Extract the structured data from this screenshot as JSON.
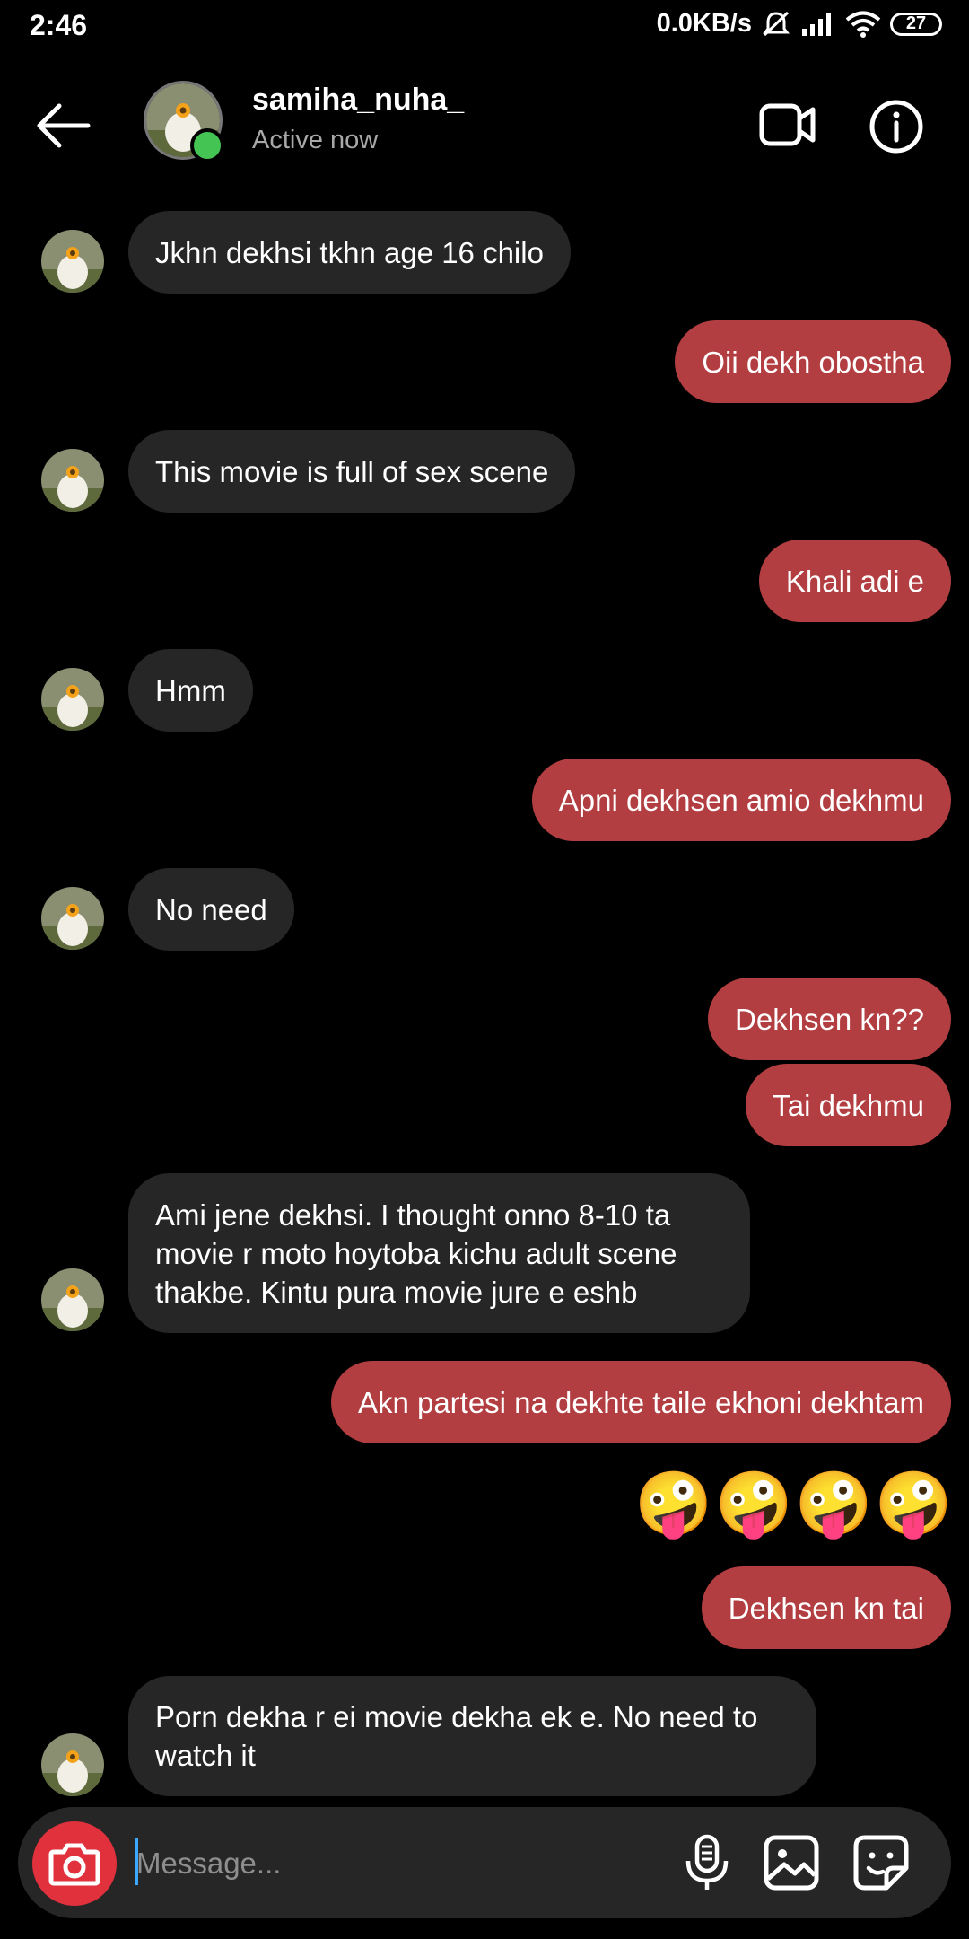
{
  "status_bar": {
    "time": "2:46",
    "network_speed": "0.0KB/s",
    "battery": "27",
    "icons": [
      "mute-icon",
      "signal-icon",
      "wifi-icon",
      "battery-icon"
    ]
  },
  "header": {
    "username": "samiha_nuha_",
    "status": "Active now",
    "icons": [
      "back-arrow-icon",
      "video-call-icon",
      "info-icon"
    ],
    "online_color": "#44c553"
  },
  "messages": [
    {
      "from": "them",
      "text": "Jkhn dekhsi tkhn age 16 chilo"
    },
    {
      "from": "me",
      "text": "Oii dekh obostha"
    },
    {
      "from": "them",
      "text": "This movie is full of sex scene"
    },
    {
      "from": "me",
      "text": "Khali adi e"
    },
    {
      "from": "them",
      "text": "Hmm"
    },
    {
      "from": "me",
      "text": "Apni dekhsen amio dekhmu"
    },
    {
      "from": "them",
      "text": "No need"
    },
    {
      "from": "me",
      "text": "Dekhsen kn??"
    },
    {
      "from": "me",
      "text": "Tai dekhmu"
    },
    {
      "from": "them",
      "text": "Ami jene dekhsi. I thought onno 8-10 ta movie r moto hoytoba kichu adult scene thakbe. Kintu pura movie jure e eshb"
    },
    {
      "from": "me",
      "text": "Akn partesi na dekhte taile ekhoni dekhtam"
    },
    {
      "from": "me",
      "text": "🤪🤪🤪🤪"
    },
    {
      "from": "me",
      "text": "Dekhsen kn tai"
    },
    {
      "from": "them",
      "text": "Porn dekha r ei movie dekha ek e. No need to watch it"
    }
  ],
  "composer": {
    "placeholder": "Message...",
    "icons": [
      "camera-icon",
      "microphone-icon",
      "gallery-icon",
      "sticker-icon"
    ]
  },
  "colors": {
    "background": "#000000",
    "incoming_bubble": "#262626",
    "outgoing_bubble": "#b23e41",
    "camera_button": "#e0313d"
  }
}
